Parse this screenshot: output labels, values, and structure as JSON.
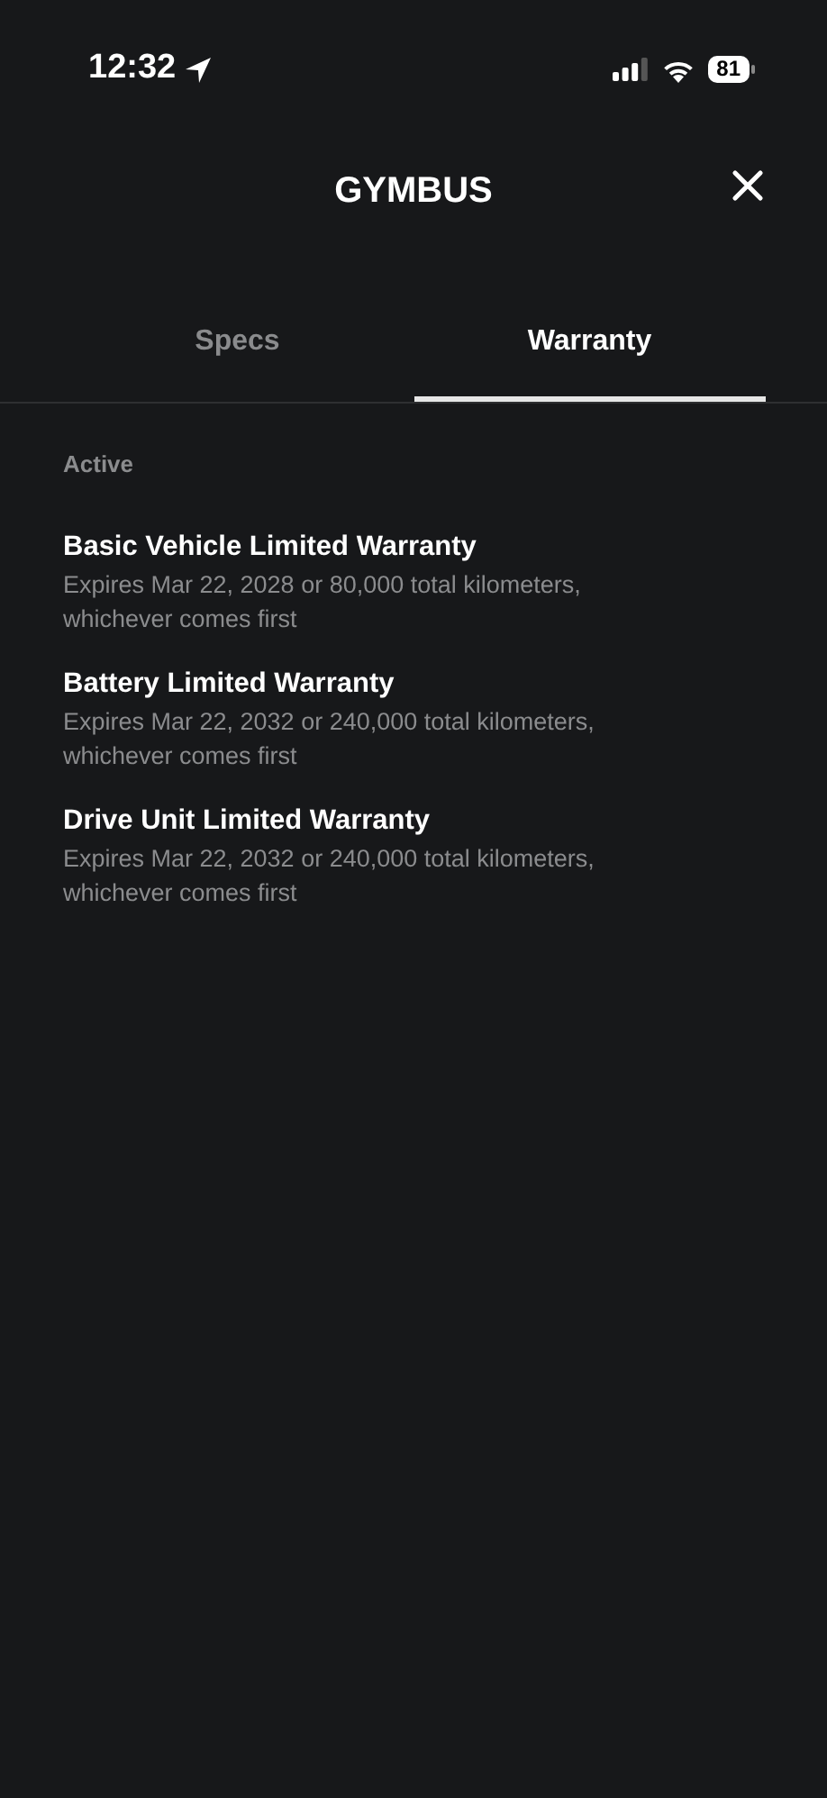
{
  "status_bar": {
    "time": "12:32",
    "battery": "81"
  },
  "header": {
    "title": "GYMBUS"
  },
  "tabs": [
    {
      "label": "Specs",
      "selected": false
    },
    {
      "label": "Warranty",
      "selected": true
    }
  ],
  "section": {
    "heading": "Active"
  },
  "warranties": [
    {
      "title": "Basic Vehicle Limited Warranty",
      "description": "Expires Mar 22, 2028 or 80,000 total kilometers, whichever comes first"
    },
    {
      "title": "Battery Limited Warranty",
      "description": "Expires Mar 22, 2032 or 240,000 total kilometers, whichever comes first"
    },
    {
      "title": "Drive Unit Limited Warranty",
      "description": "Expires Mar 22, 2032 or 240,000 total kilometers, whichever comes first"
    }
  ]
}
